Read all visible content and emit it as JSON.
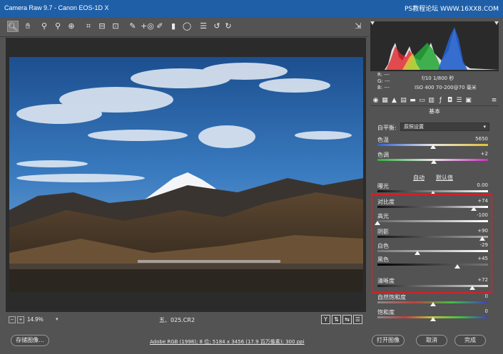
{
  "titlebar": {
    "title": "Camera Raw 9.7 -  Canon EOS-1D X",
    "watermark": "PS教程论坛 WWW.16XX8.COM"
  },
  "toolbar": {
    "tools": [
      "zoom-icon",
      "hand-icon",
      "white-balance-icon",
      "color-sampler-icon",
      "targeted-adjust-icon",
      "crop-icon",
      "straighten-icon",
      "transform-icon",
      "spot-removal-icon",
      "red-eye-icon",
      "adjustment-brush-icon",
      "graduated-filter-icon",
      "radial-filter-icon",
      "preferences-icon",
      "rotate-left-icon",
      "rotate-right-icon"
    ],
    "fullscreen": "fullscreen-icon"
  },
  "bottom": {
    "zoom_minus": "−",
    "zoom_plus": "+",
    "zoom_value": "14.9%",
    "filename": "五、025.CR2",
    "view_y": "Y"
  },
  "footer": {
    "save_label": "存储图像...",
    "workflow": "Adobe RGB (1998); 8 位; 5184 x 3456 (17.9 百万像素); 300 ppi",
    "open_label": "打开图像",
    "cancel_label": "取消",
    "done_label": "完成"
  },
  "caminfo": {
    "r": "R:  ---",
    "g": "G:  ---",
    "b": "B:  ---",
    "aperture_shutter": "f/10   1/800 秒",
    "iso_lens": "ISO 400   70-200@70 毫米"
  },
  "panel": {
    "section_title": "基本",
    "wb_label": "白平衡:",
    "wb_value": "原照设置",
    "auto_label": "自动",
    "default_label": "默认值",
    "sliders": [
      {
        "label": "色温",
        "value": "5650",
        "pos": 0.5
      },
      {
        "label": "色调",
        "value": "+2",
        "pos": 0.51
      },
      {
        "label": "曝光",
        "value": "0.00",
        "pos": 0.5
      },
      {
        "label": "对比度",
        "value": "+74",
        "pos": 0.87
      },
      {
        "label": "高光",
        "value": "-100",
        "pos": 0.0
      },
      {
        "label": "阴影",
        "value": "+90",
        "pos": 0.95
      },
      {
        "label": "白色",
        "value": "-29",
        "pos": 0.36
      },
      {
        "label": "黑色",
        "value": "+45",
        "pos": 0.72
      },
      {
        "label": "清晰度",
        "value": "+72",
        "pos": 0.86
      },
      {
        "label": "自然饱和度",
        "value": "0",
        "pos": 0.5
      },
      {
        "label": "饱和度",
        "value": "0",
        "pos": 0.5
      }
    ]
  }
}
